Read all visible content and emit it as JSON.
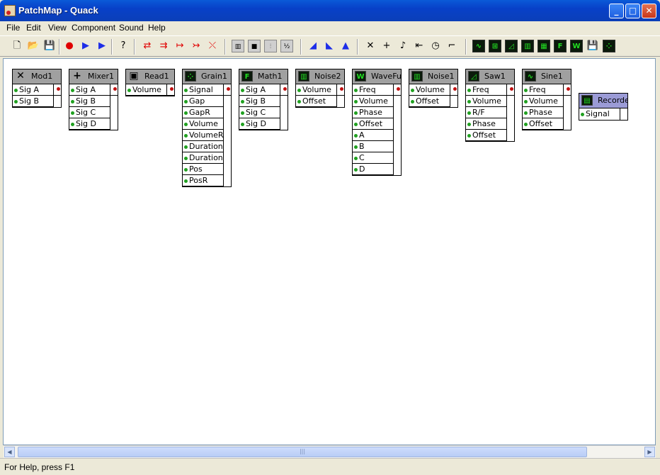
{
  "window": {
    "title": "PatchMap - Quack"
  },
  "menu": [
    "File",
    "Edit",
    "View",
    "Component",
    "Sound",
    "Help"
  ],
  "toolbar": {
    "icons": [
      "new-icon",
      "open-icon",
      "save-icon",
      "record-icon",
      "play-icon",
      "play-record-icon",
      "help-icon",
      "connect-icon",
      "connect-multi-icon",
      "connect-in-icon",
      "connect-out-icon",
      "disconnect-icon",
      "piano-icon",
      "stop-square-icon",
      "waveform-icon",
      "fraction-icon",
      "ramp-up-icon",
      "ramp-mid-icon",
      "ramp-down-icon",
      "multiply-icon",
      "add-icon",
      "note-icon",
      "step-back-icon",
      "clock-icon",
      "step-icon",
      "sine-icon",
      "grid-icon",
      "saw-icon",
      "noise-icon",
      "noise2-icon",
      "function-icon",
      "wave-icon",
      "disk-icon",
      "grain-icon"
    ],
    "labels": {
      "fn": "F",
      "wave": "W",
      "fraction": "½"
    }
  },
  "nodes": [
    {
      "name": "Mod1",
      "icon": "multiply-icon",
      "glyph": "✕",
      "inputs": [
        "Sig A",
        "Sig B"
      ]
    },
    {
      "name": "Mixer1",
      "icon": "add-icon",
      "glyph": "+",
      "inputs": [
        "Sig A",
        "Sig B",
        "Sig C",
        "Sig D"
      ]
    },
    {
      "name": "Read1",
      "icon": "disk-icon",
      "glyph": "▣",
      "inputs": [
        "Volume"
      ]
    },
    {
      "name": "Grain1",
      "icon": "grain-icon",
      "glyph": "⁘",
      "inputs": [
        "Signal",
        "Gap",
        "GapR",
        "Volume",
        "VolumeR",
        "Duration",
        "DurationR",
        "Pos",
        "PosR"
      ]
    },
    {
      "name": "Math1",
      "icon": "function-icon",
      "glyph": "F",
      "inputs": [
        "Sig A",
        "Sig B",
        "Sig C",
        "Sig D"
      ]
    },
    {
      "name": "Noise2",
      "icon": "noise-icon",
      "glyph": "▥",
      "inputs": [
        "Volume",
        "Offset"
      ]
    },
    {
      "name": "WaveFu",
      "icon": "wave-icon",
      "glyph": "W",
      "inputs": [
        "Freq",
        "Volume",
        "Phase",
        "Offset",
        "A",
        "B",
        "C",
        "D"
      ]
    },
    {
      "name": "Noise1",
      "icon": "noise-icon",
      "glyph": "▥",
      "inputs": [
        "Volume",
        "Offset"
      ]
    },
    {
      "name": "Saw1",
      "icon": "saw-icon",
      "glyph": "◿",
      "inputs": [
        "Freq",
        "Volume",
        "R/F",
        "Phase",
        "Offset"
      ]
    },
    {
      "name": "Sine1",
      "icon": "sine-icon",
      "glyph": "∿",
      "inputs": [
        "Freq",
        "Volume",
        "Phase",
        "Offset"
      ]
    },
    {
      "name": "Recorde",
      "icon": "recorder-icon",
      "glyph": "▤",
      "inputs": [
        "Signal"
      ]
    }
  ],
  "status": {
    "text": "For Help, press F1"
  }
}
